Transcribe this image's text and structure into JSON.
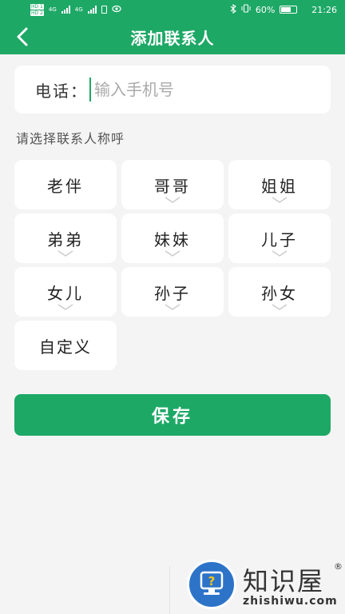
{
  "status_bar": {
    "sim1": "HD 1",
    "sim2": "HD 2",
    "net1": "4G",
    "net2": "4G",
    "battery_text": "60%",
    "time": "21:26"
  },
  "header": {
    "title": "添加联系人"
  },
  "phone": {
    "label": "电话：",
    "placeholder": "输入手机号",
    "value": ""
  },
  "section_label": "请选择联系人称呼",
  "relations": [
    {
      "label": "老伴",
      "has_dropdown": false
    },
    {
      "label": "哥哥",
      "has_dropdown": true
    },
    {
      "label": "姐姐",
      "has_dropdown": true
    },
    {
      "label": "弟弟",
      "has_dropdown": true
    },
    {
      "label": "妹妹",
      "has_dropdown": true
    },
    {
      "label": "儿子",
      "has_dropdown": true
    },
    {
      "label": "女儿",
      "has_dropdown": true
    },
    {
      "label": "孙子",
      "has_dropdown": true
    },
    {
      "label": "孙女",
      "has_dropdown": true
    },
    {
      "label": "自定义",
      "has_dropdown": false
    }
  ],
  "save_label": "保存",
  "watermark": {
    "brand": "知识屋",
    "domain": "zhishiwu.com",
    "reg": "®"
  },
  "colors": {
    "primary": "#1ea866",
    "background": "#f4f4f4",
    "card": "#ffffff"
  }
}
